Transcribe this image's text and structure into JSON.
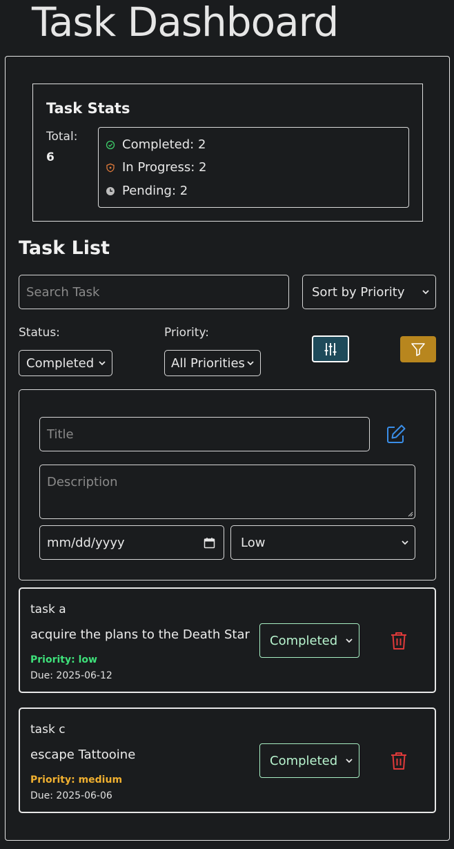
{
  "header": {
    "title": "Task Dashboard"
  },
  "stats": {
    "title": "Task Stats",
    "total_label": "Total:",
    "total_value": "6",
    "completed": "Completed: 2",
    "in_progress": "In Progress: 2",
    "pending": "Pending: 2"
  },
  "task_list": {
    "title": "Task List",
    "search_placeholder": "Search Task",
    "sort_value": "Sort by Priority",
    "status_label": "Status:",
    "status_value": "Completed",
    "priority_label": "Priority:",
    "priority_value": "All Priorities"
  },
  "form": {
    "title_placeholder": "Title",
    "description_placeholder": "Description",
    "date_placeholder": "mm/dd/yyyy",
    "priority_value": "Low"
  },
  "tasks": [
    {
      "title": "task a",
      "description": "acquire the plans to the Death Star",
      "priority": "Priority: low",
      "due": "Due: 2025-06-12",
      "status": "Completed"
    },
    {
      "title": "task c",
      "description": "escape Tattooine",
      "priority": "Priority: medium",
      "due": "Due: 2025-06-06",
      "status": "Completed"
    }
  ],
  "colors": {
    "background": "#1a1c1e",
    "completed_green": "#3ecf6a",
    "in_progress_orange": "#e07a3a",
    "priority_low": "#3ee07a",
    "priority_medium": "#f0b030",
    "settings_button": "#1e4a5a",
    "filter_button": "#b8861e",
    "edit_blue": "#3a8ee8",
    "delete_red": "#e03a3a"
  },
  "icons": {
    "completed": "check-circle-icon",
    "in_progress": "shield-icon",
    "pending": "clock-icon",
    "settings": "sliders-icon",
    "filter": "funnel-icon",
    "edit": "pencil-square-icon",
    "delete": "trash-icon",
    "calendar": "calendar-icon"
  }
}
